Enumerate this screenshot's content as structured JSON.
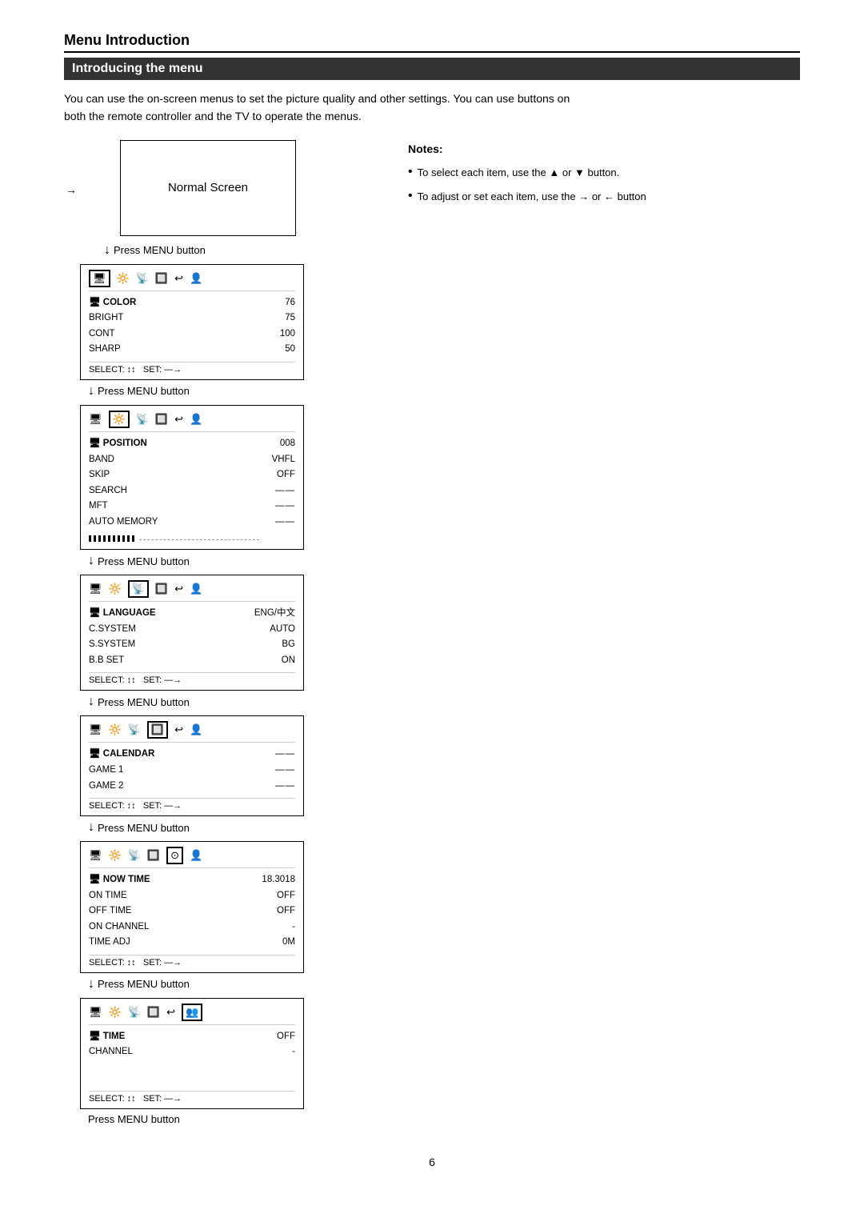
{
  "header": {
    "section_title": "Menu Introduction",
    "subtitle": "Introducing the menu",
    "intro_text_1": "You can use the on-screen menus to set the picture quality and other settings. You can use buttons on",
    "intro_text_2": "both the remote controller and the TV to operate the menus."
  },
  "notes": {
    "title": "Notes:",
    "items": [
      "To select each item, use the ▲ or ▼ button.",
      "To adjust or set each item, use the → or ← button"
    ]
  },
  "normal_screen": {
    "label": "Normal Screen",
    "arrow": "→"
  },
  "press_menu": "Press MENU button",
  "panels": [
    {
      "id": "panel1",
      "icons": [
        "📺",
        "🔆",
        "🔲",
        "📷",
        "↩",
        "👤"
      ],
      "active_icon_index": 0,
      "rows": [
        {
          "label": "COLOR",
          "value": "76",
          "bold": true
        },
        {
          "label": "BRIGHT",
          "value": "75"
        },
        {
          "label": "CONT",
          "value": "100"
        },
        {
          "label": "SHARP",
          "value": "50"
        }
      ],
      "select_line": "SELECT: ↕↕   SET: —→"
    },
    {
      "id": "panel2",
      "icons": [
        "📺",
        "🔆",
        "🔲",
        "📷",
        "↩",
        "👤"
      ],
      "active_icon_index": 1,
      "rows": [
        {
          "label": "POSITION",
          "value": "008",
          "bold": true
        },
        {
          "label": "BAND",
          "value": "VHFL"
        },
        {
          "label": "SKIP",
          "value": "OFF"
        },
        {
          "label": "SEARCH",
          "value": "——"
        },
        {
          "label": "MFT",
          "value": "——"
        },
        {
          "label": "AUTO MEMORY",
          "value": "——"
        }
      ],
      "has_hatch": true
    },
    {
      "id": "panel3",
      "icons": [
        "📺",
        "🔆",
        "🔲",
        "📷",
        "↩",
        "👤"
      ],
      "active_icon_index": 2,
      "rows": [
        {
          "label": "LANGUAGE",
          "value": "ENG/中文",
          "bold": true
        },
        {
          "label": "C.SYSTEM",
          "value": "AUTO"
        },
        {
          "label": "S.SYSTEM",
          "value": "BG"
        },
        {
          "label": "B.B SET",
          "value": "ON"
        }
      ],
      "select_line": "SELECT: ↕↕   SET: —→"
    },
    {
      "id": "panel4",
      "icons": [
        "📺",
        "🔆",
        "🔲",
        "📷",
        "↩",
        "👤"
      ],
      "active_icon_index": 3,
      "rows": [
        {
          "label": "CALENDAR",
          "value": "——",
          "bold": true
        },
        {
          "label": "GAME 1",
          "value": "——"
        },
        {
          "label": "GAME 2",
          "value": "——"
        }
      ],
      "select_line": "SELECT: ↕↕   SET: —→"
    },
    {
      "id": "panel5",
      "icons": [
        "📺",
        "🔆",
        "🔲",
        "📷",
        "⊙",
        "👤"
      ],
      "active_icon_index": 4,
      "rows": [
        {
          "label": "NOW TIME",
          "value": "18.3018",
          "bold": true
        },
        {
          "label": "ON  TIME",
          "value": "OFF"
        },
        {
          "label": "OFF TIME",
          "value": "OFF"
        },
        {
          "label": "ON CHANNEL",
          "value": "-"
        },
        {
          "label": "TIME ADJ",
          "value": "0M"
        }
      ],
      "select_line": "SELECT: ↕↕   SET: —→"
    },
    {
      "id": "panel6",
      "icons": [
        "📺",
        "🔆",
        "🔲",
        "📷",
        "↩",
        "👥"
      ],
      "active_icon_index": 5,
      "rows": [
        {
          "label": "TIME",
          "value": "OFF",
          "bold": true
        },
        {
          "label": "CHANNEL",
          "value": "-"
        }
      ],
      "select_line": "SELECT: ↕↕   SET: —→",
      "is_last": true
    }
  ],
  "page_number": "6"
}
